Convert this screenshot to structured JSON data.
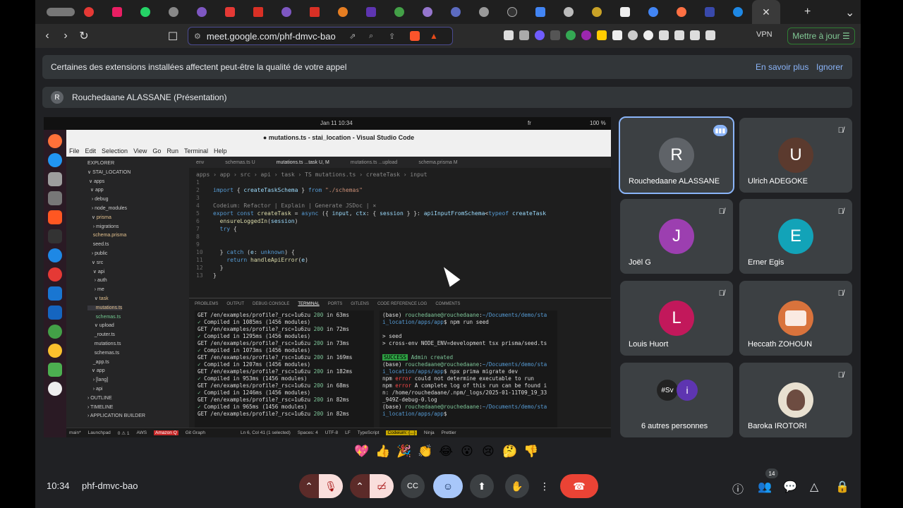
{
  "browser": {
    "url": "meet.google.com/phf-dmvc-bao",
    "vpn_label": "VPN",
    "update_button": "Mettre à jour",
    "tab_close": "✕",
    "new_tab": "+",
    "tab_menu": "⌄"
  },
  "banner": {
    "text": "Certaines des extensions installées affectent peut-être la qualité de votre appel",
    "learn_more": "En savoir plus",
    "ignore": "Ignorer"
  },
  "presenter": {
    "initial": "R",
    "label": "Rouchedaane ALASSANE (Présentation)"
  },
  "screen": {
    "clock": "Jan 11  10:34",
    "lang": "fr",
    "battery": "100 %",
    "window_title": "● mutations.ts - stai_location - Visual Studio Code",
    "menu": [
      "File",
      "Edit",
      "Selection",
      "View",
      "Go",
      "Run",
      "Terminal",
      "Help"
    ],
    "editor_tabs": [
      "env",
      "schemas.ts U",
      "mutations.ts ...task U, M",
      "mutations.ts ...upload",
      "schema.prisma M"
    ],
    "terminal_tabs": [
      "PROBLEMS",
      "OUTPUT",
      "DEBUG CONSOLE",
      "TERMINAL",
      "PORTS",
      "GITLENS",
      "CODE REFERENCE LOG",
      "COMMENTS"
    ],
    "statusbar": [
      "main*",
      "Launchpad",
      "0 ⚠ 1",
      "AWS",
      "Amazon Q",
      "Git Graph",
      "Ln 6, Col 41 (1 selected)",
      "Spaces: 4",
      "UTF-8",
      "LF",
      "TypeScript",
      "Codeium: {...}",
      "Ninja",
      "Prettier"
    ]
  },
  "participants": [
    {
      "initial": "R",
      "name": "Rouchedaane ALASSANE",
      "color": "#5f6368",
      "speaking": true
    },
    {
      "initial": "U",
      "name": "Ulrich ADEGOKE",
      "color": "#5b3a2e",
      "speaking": false
    },
    {
      "initial": "J",
      "name": "Joël G",
      "color": "#9c3fb0",
      "speaking": false
    },
    {
      "initial": "E",
      "name": "Erner Egis",
      "color": "#12a3b8",
      "speaking": false
    },
    {
      "initial": "L",
      "name": "Louis Huort",
      "color": "#c2185b",
      "speaking": false
    },
    {
      "initial": "",
      "name": "Heccath ZOHOUN",
      "color": "#d9733c",
      "speaking": false
    },
    {
      "initial": "",
      "name": "6 autres personnes",
      "color": "#3c4043",
      "speaking": false
    },
    {
      "initial": "",
      "name": "Baroka IROTORI",
      "color": "#e8e0d0",
      "speaking": false
    }
  ],
  "others_avatars": [
    "#Sv",
    "i"
  ],
  "reactions": [
    "💖",
    "👍",
    "🎉",
    "👏",
    "😂",
    "😮",
    "😢",
    "🤔",
    "👎"
  ],
  "bottom": {
    "time": "10:34",
    "meet_code": "phf-dmvc-bao",
    "people_count": "14"
  }
}
